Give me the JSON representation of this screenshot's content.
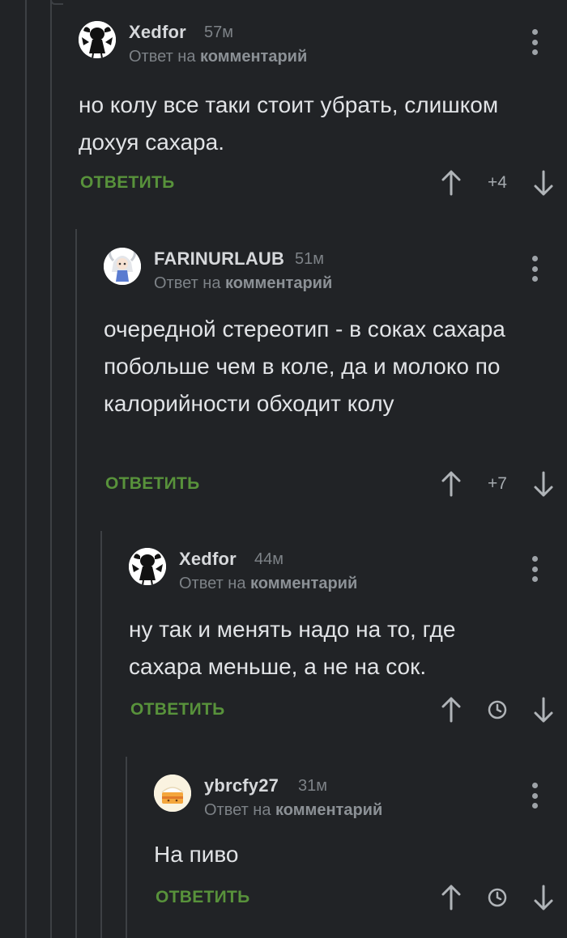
{
  "comments": [
    {
      "username": "Xedfor",
      "time": "57м",
      "reply_prefix": "Ответ на",
      "reply_target": "комментарий",
      "text": "но колу все таки стоит убрать, слишком дохуя сахара.",
      "reply_label": "ОТВЕТИТЬ",
      "rating": "+4",
      "avatar": "girl-silhouette-avatar"
    },
    {
      "username": "FARINURLAUB",
      "time": "51м",
      "reply_prefix": "Ответ на",
      "reply_target": "комментарий",
      "text": "очередной стереотип - в соках сахара побольше чем в коле, да и молоко по калорийности обходит колу",
      "reply_label": "ОТВЕТИТЬ",
      "rating": "+7",
      "avatar": "anime-girl-avatar"
    },
    {
      "username": "Xedfor",
      "time": "44м",
      "reply_prefix": "Ответ на",
      "reply_target": "комментарий",
      "text": "ну так и менять надо на то, где сахара меньше, а не на сок.",
      "reply_label": "ОТВЕТИТЬ",
      "rating_pending": "clock-icon",
      "avatar": "girl-silhouette-avatar"
    },
    {
      "username": "ybrcfy27",
      "time": "31м",
      "reply_prefix": "Ответ на",
      "reply_target": "комментарий",
      "text": "На пиво",
      "reply_label": "ОТВЕТИТЬ",
      "rating_pending": "clock-icon",
      "avatar": "cake-avatar"
    }
  ],
  "colors": {
    "background": "#212326",
    "reply_button": "#58923b",
    "thread_line": "#3d4044"
  }
}
